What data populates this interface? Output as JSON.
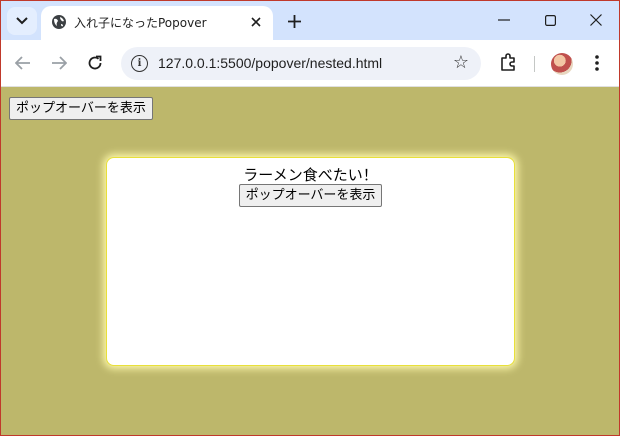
{
  "browser": {
    "tab_title": "入れ子になったPopover",
    "url": "127.0.0.1:5500/popover/nested.html",
    "tab_menu_icon": "chevron-down-icon",
    "favicon": "globe-icon"
  },
  "page": {
    "main_button_label": "ポップオーバーを表示",
    "popover": {
      "text": "ラーメン食べたい！",
      "button_label": "ポップオーバーを表示"
    }
  },
  "colors": {
    "page_background": "#bdb76b",
    "tabbar_background": "#d3e3fd",
    "popover_border": "#e8e03a",
    "popover_glow": "#fffaaa"
  }
}
